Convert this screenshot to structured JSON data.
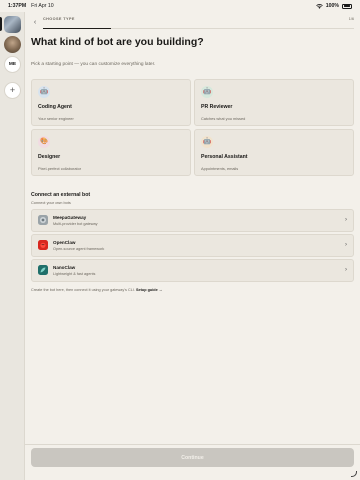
{
  "status_bar": {
    "time": "1:37PM",
    "date": "Fri Apr 10",
    "battery": "100%"
  },
  "rail": {
    "me_label": "ME",
    "add_label": "+"
  },
  "header": {
    "back": "‹",
    "step_label": "CHOOSE TYPE",
    "step_count": "1/6",
    "progress": 0.22
  },
  "title": "What kind of bot are you building?",
  "subtitle": "Pick a starting point — you can customize everything later.",
  "bot_types": [
    {
      "name": "Coding Agent",
      "desc": "Your senior engineer",
      "icon": "robot-icon",
      "glyph": "🤖",
      "bubble": "#d7e3ee"
    },
    {
      "name": "PR Reviewer",
      "desc": "Catches what you missed",
      "icon": "reviewer-icon",
      "glyph": "🤖",
      "bubble": "#d6e8dc"
    },
    {
      "name": "Designer",
      "desc": "Pixel-perfect collaborator",
      "icon": "designer-icon",
      "glyph": "🎨",
      "bubble": "#f1dbe2"
    },
    {
      "name": "Personal Assistant",
      "desc": "Appointments, emails",
      "icon": "assistant-icon",
      "glyph": "🤖",
      "bubble": "#f1e3cd"
    }
  ],
  "external": {
    "title": "Connect an external bot",
    "subtitle": "Connect your own bots",
    "items": [
      {
        "name": "MeepaGateway",
        "desc": "Multi-provider bot gateway",
        "icon": "gateway-icon",
        "color": "#9aa3a8"
      },
      {
        "name": "OpenClaw",
        "desc": "Open-source agent framework",
        "icon": "openclaw-icon",
        "color": "#d8271f"
      },
      {
        "name": "NanoClaw",
        "desc": "Lightweight & fast agents",
        "icon": "nanoclaw-icon",
        "color": "#1f6f6a"
      }
    ],
    "chevron": "›"
  },
  "footnote": {
    "text": "Create the bot here, then connect it using your gateway's CLI.",
    "link": "Setup guide →"
  },
  "continue_label": "Continue"
}
